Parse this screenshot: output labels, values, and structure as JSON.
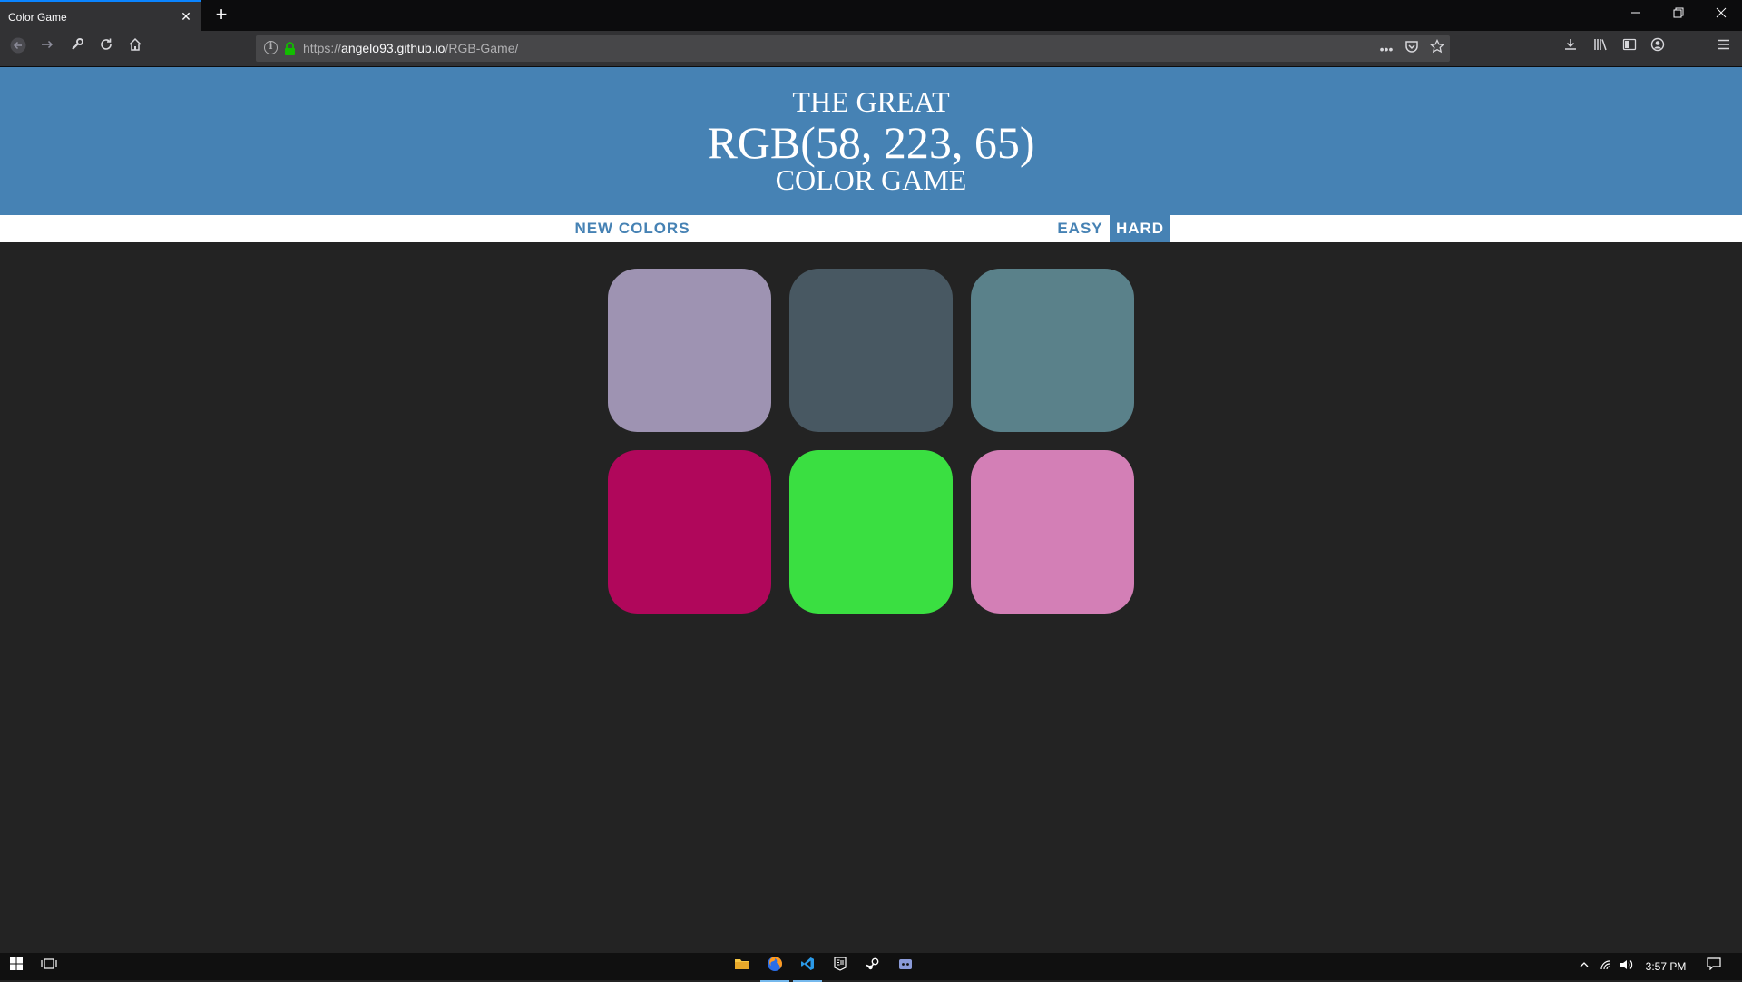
{
  "browser": {
    "tab_title": "Color Game",
    "tab_close": "✕",
    "new_tab": "+",
    "url_scheme": "https://",
    "url_host": "angelo93.github.io",
    "url_path": "/RGB-Game/",
    "page_actions": "•••"
  },
  "game": {
    "title_line1": "THE GREAT",
    "title_rgb": "RGB(58, 223, 65)",
    "title_line3": "COLOR GAME",
    "new_colors_label": "New Colors",
    "easy_label": "Easy",
    "hard_label": "Hard",
    "selected_mode": "hard",
    "header_color": "#4682b4",
    "background_color": "#232323",
    "squares": [
      {
        "color": "#9e93b2"
      },
      {
        "color": "#485862"
      },
      {
        "color": "#5a818a"
      },
      {
        "color": "#b0075b"
      },
      {
        "color": "#3adf41"
      },
      {
        "color": "#d37fb6"
      }
    ]
  },
  "taskbar": {
    "clock": "3:57 PM"
  }
}
